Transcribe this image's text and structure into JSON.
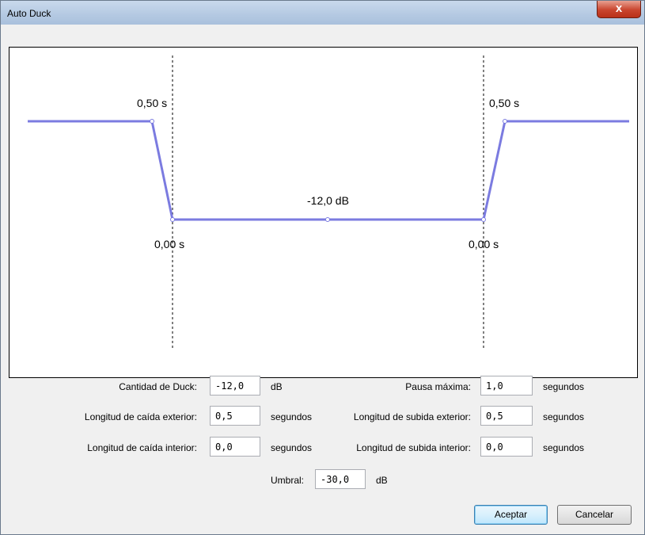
{
  "window": {
    "title": "Auto Duck",
    "close_icon": "close-icon",
    "close_glyph": "x"
  },
  "graph": {
    "outer_fade_down_label": "0,50 s",
    "inner_fade_down_label": "0,00 s",
    "duck_amount_label": "-12,0 dB",
    "inner_fade_up_label": "0,00 s",
    "outer_fade_up_label": "0,50 s",
    "line_color": "#7b7be0"
  },
  "form": {
    "duck_amount": {
      "label": "Cantidad de Duck:",
      "value": "-12,0",
      "unit": "dB"
    },
    "max_pause": {
      "label": "Pausa máxima:",
      "value": "1,0",
      "unit": "segundos"
    },
    "outer_fade_down": {
      "label": "Longitud de caída exterior:",
      "value": "0,5",
      "unit": "segundos"
    },
    "outer_fade_up": {
      "label": "Longitud de subida exterior:",
      "value": "0,5",
      "unit": "segundos"
    },
    "inner_fade_down": {
      "label": "Longitud de caída interior:",
      "value": "0,0",
      "unit": "segundos"
    },
    "inner_fade_up": {
      "label": "Longitud de subida interior:",
      "value": "0,0",
      "unit": "segundos"
    },
    "threshold": {
      "label": "Umbral:",
      "value": "-30,0",
      "unit": "dB"
    }
  },
  "buttons": {
    "ok": "Aceptar",
    "cancel": "Cancelar"
  }
}
